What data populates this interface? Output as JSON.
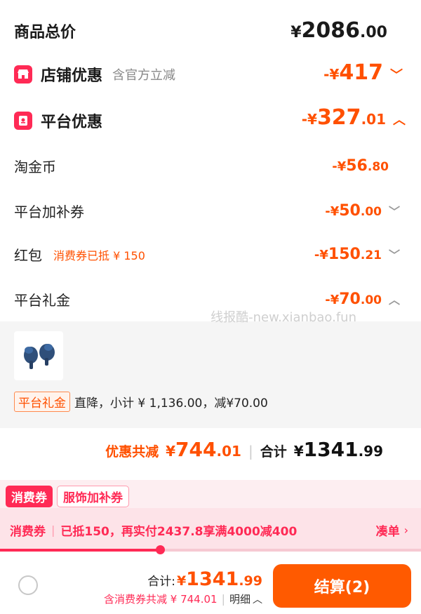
{
  "summary": {
    "title": "商品总价",
    "total": {
      "currency": "¥",
      "int": "2086",
      "dec": ".00"
    }
  },
  "shop": {
    "title": "店铺优惠",
    "note": "含官方立减",
    "amount": {
      "prefix": "-¥",
      "int": "417",
      "dec": ""
    }
  },
  "platform": {
    "title": "平台优惠",
    "amount": {
      "prefix": "-¥",
      "int": "327",
      "dec": ".01"
    },
    "items": [
      {
        "label": "淘金币",
        "note": "",
        "prefix": "-¥",
        "int": "56",
        "dec": ".80"
      },
      {
        "label": "平台加补券",
        "note": "",
        "prefix": "-¥",
        "int": "50",
        "dec": ".00"
      },
      {
        "label": "红包",
        "note": "消费券已抵 ¥ 150",
        "prefix": "-¥",
        "int": "150",
        "dec": ".21"
      },
      {
        "label": "平台礼金",
        "note": "",
        "prefix": "-¥",
        "int": "70",
        "dec": ".00"
      }
    ]
  },
  "watermark": "线报酷-new.xianbao.fun",
  "gift_detail": {
    "tag": "平台礼金",
    "text": "直降，小计 ¥ 1,136.00，减¥70.00"
  },
  "totals": {
    "discount_label": "优惠共减",
    "discount": {
      "prefix": "¥",
      "int": "744",
      "dec": ".01"
    },
    "sum_label": "合计",
    "sum": {
      "prefix": "¥",
      "int": "1341",
      "dec": ".99"
    }
  },
  "coupon_tabs": [
    "消费券",
    "服饰加补券"
  ],
  "coupon_banner": {
    "label": "消费券",
    "text": "已抵150，再实付2437.8享满4000减400",
    "link": "凑单",
    "progress": 0.38
  },
  "footer": {
    "sum_label": "合计:",
    "sum": {
      "prefix": "¥",
      "int": "1341",
      "dec": ".99"
    },
    "sub_text": "含消费券共减 ¥ 744.01",
    "detail_link": "明细",
    "checkout": "结算(2)"
  },
  "colors": {
    "accent": "#ff5000",
    "pink": "#ff2a55",
    "checkout_bg": "#ff5a00"
  }
}
